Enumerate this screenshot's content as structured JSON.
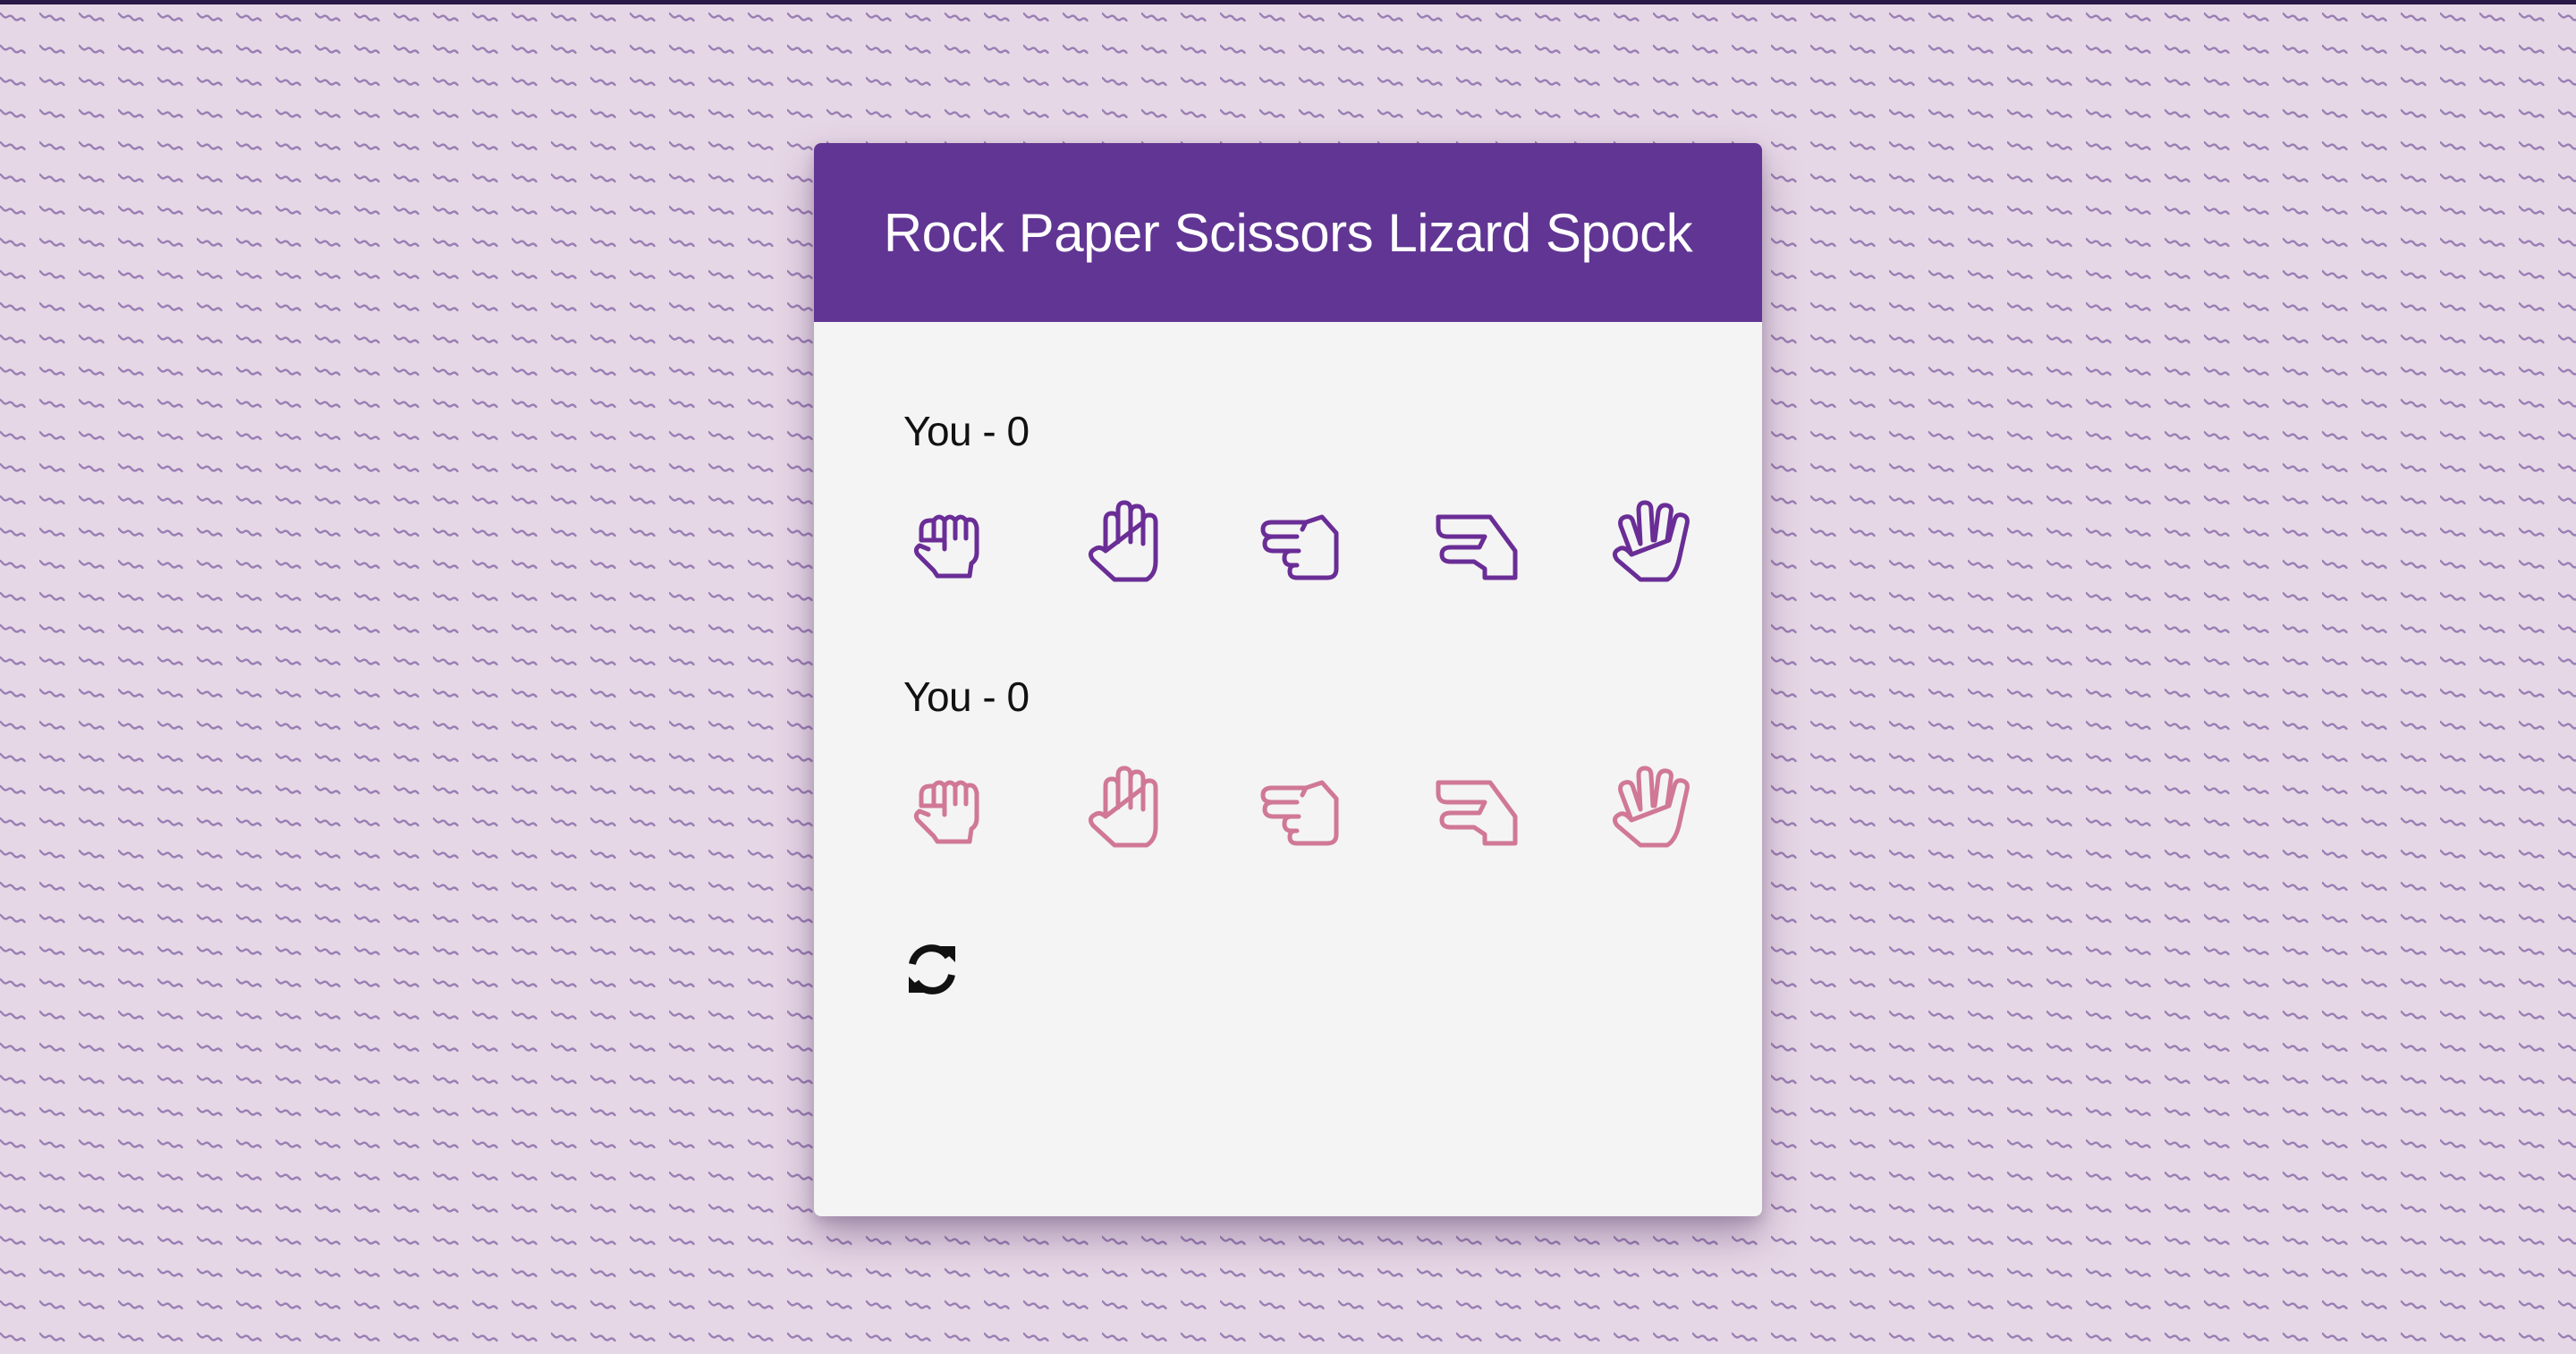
{
  "app": {
    "title": "Rock Paper Scissors Lizard Spock"
  },
  "players": [
    {
      "label": "You - 0",
      "color": "#6a2d96",
      "choices": [
        {
          "name": "rock",
          "icon": "hand-rock-icon"
        },
        {
          "name": "paper",
          "icon": "hand-paper-icon"
        },
        {
          "name": "scissors",
          "icon": "hand-scissors-icon"
        },
        {
          "name": "lizard",
          "icon": "hand-lizard-icon"
        },
        {
          "name": "spock",
          "icon": "hand-spock-icon"
        }
      ]
    },
    {
      "label": "You - 0",
      "color": "#d07896",
      "choices": [
        {
          "name": "rock",
          "icon": "hand-rock-icon"
        },
        {
          "name": "paper",
          "icon": "hand-paper-icon"
        },
        {
          "name": "scissors",
          "icon": "hand-scissors-icon"
        },
        {
          "name": "lizard",
          "icon": "hand-lizard-icon"
        },
        {
          "name": "spock",
          "icon": "hand-spock-icon"
        }
      ]
    }
  ],
  "reset": {
    "icon": "refresh-icon"
  },
  "colors": {
    "header": "#613593",
    "card": "#f4f4f4",
    "background": "#e6d7e6",
    "pattern": "#9a7fb4"
  }
}
